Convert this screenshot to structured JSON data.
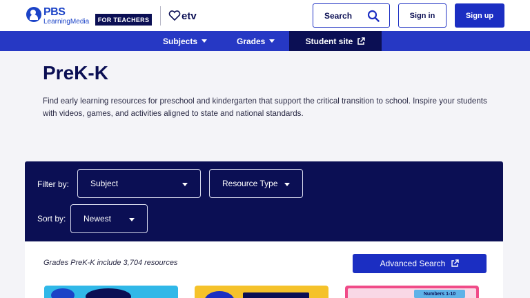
{
  "header": {
    "logo_word": "PBS",
    "logo_sub": "LearningMedia",
    "audience_badge": "FOR TEACHERS",
    "station_logo": "etv",
    "search_label": "Search",
    "signin_label": "Sign in",
    "signup_label": "Sign up"
  },
  "nav": {
    "items": [
      {
        "label": "Subjects",
        "icon": "chevron-down-icon"
      },
      {
        "label": "Grades",
        "icon": "chevron-down-icon"
      },
      {
        "label": "Student site",
        "icon": "external-link-icon"
      }
    ]
  },
  "hero": {
    "title": "PreK-K",
    "description": "Find early learning resources for preschool and kindergarten that support the critical transition to school. Inspire your students with videos, games, and activities aligned to state and national standards."
  },
  "filters": {
    "filter_label": "Filter by:",
    "subject_value": "Subject",
    "resource_type_value": "Resource Type",
    "sort_label": "Sort by:",
    "sort_value": "Newest"
  },
  "results": {
    "count_text": "Grades PreK-K include 3,704 resources",
    "advanced_search_label": "Advanced Search",
    "card3_tag": "Numbers 1-10"
  },
  "colors": {
    "brand_blue": "#2638c4",
    "navy": "#0b0f54",
    "page_bg": "#f4f4f8"
  }
}
